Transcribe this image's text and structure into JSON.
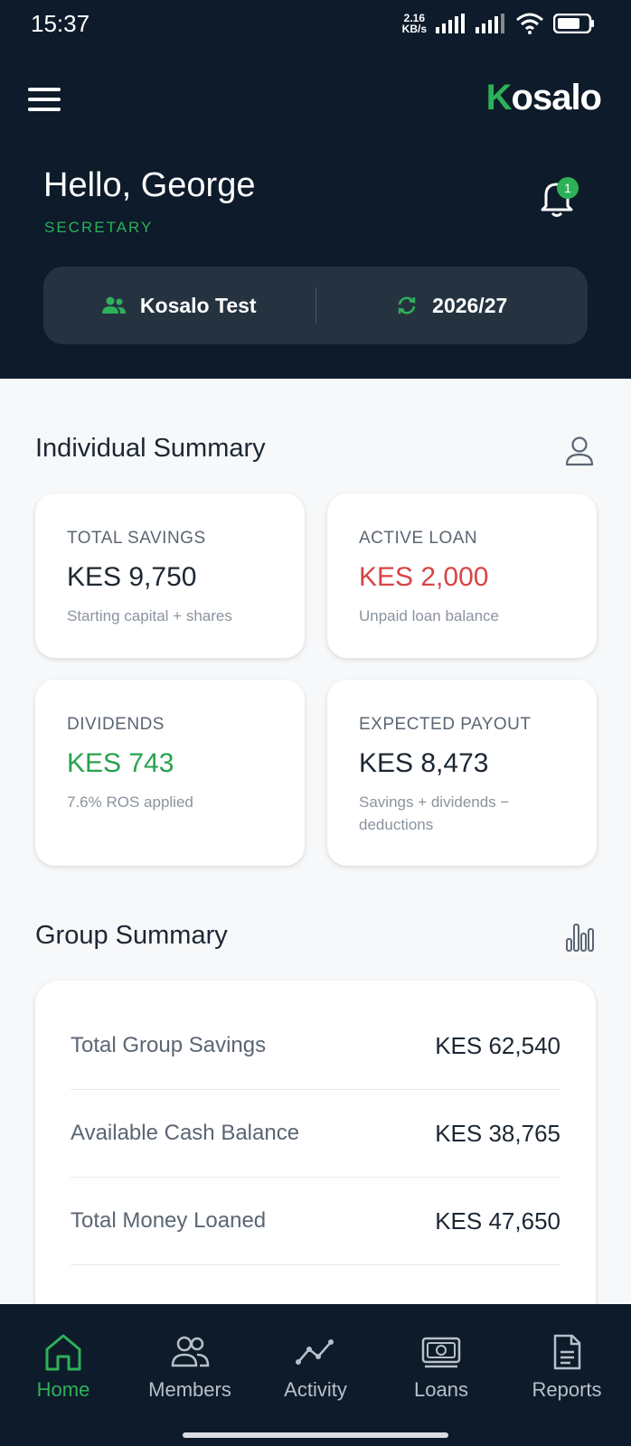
{
  "status_bar": {
    "time": "15:37",
    "net_speed_value": "2.16",
    "net_speed_unit": "KB/s"
  },
  "header": {
    "brand_initial": "K",
    "brand_rest": "osalo",
    "greeting": "Hello, George",
    "role": "SECRETARY",
    "notification_count": "1",
    "group_name": "Kosalo Test",
    "period": "2026/27"
  },
  "individual_summary": {
    "title": "Individual Summary",
    "cards": [
      {
        "label": "TOTAL SAVINGS",
        "value": "KES 9,750",
        "note": "Starting capital + shares"
      },
      {
        "label": "ACTIVE LOAN",
        "value": "KES 2,000",
        "note": "Unpaid loan balance"
      },
      {
        "label": "DIVIDENDS",
        "value": "KES 743",
        "note": "7.6% ROS applied"
      },
      {
        "label": "EXPECTED PAYOUT",
        "value": "KES 8,473",
        "note": "Savings + dividends − deductions"
      }
    ]
  },
  "group_summary": {
    "title": "Group Summary",
    "rows": [
      {
        "label": "Total Group Savings",
        "value": "KES 62,540"
      },
      {
        "label": "Available Cash Balance",
        "value": "KES 38,765"
      },
      {
        "label": "Total Money Loaned",
        "value": "KES 47,650"
      }
    ]
  },
  "bottom_nav": {
    "items": [
      {
        "label": "Home",
        "icon": "home-icon"
      },
      {
        "label": "Members",
        "icon": "members-icon"
      },
      {
        "label": "Activity",
        "icon": "activity-icon"
      },
      {
        "label": "Loans",
        "icon": "loans-icon"
      },
      {
        "label": "Reports",
        "icon": "reports-icon"
      }
    ],
    "active": "Home"
  },
  "colors": {
    "brand_green": "#2db158",
    "header_bg": "#0d1b2a",
    "loan_red": "#d64545"
  }
}
